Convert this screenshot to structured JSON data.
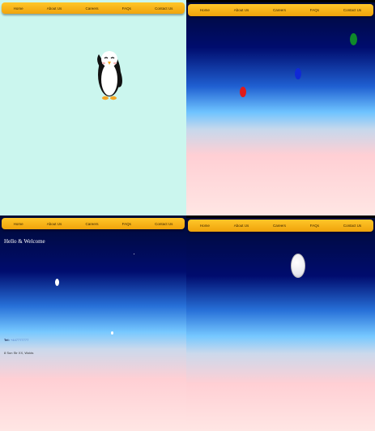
{
  "nav": {
    "items": [
      "Home",
      "About Us",
      "Careers",
      "FAQs",
      "Contact Us"
    ]
  },
  "hero": {
    "heading": "Hello & Welcome"
  },
  "contact": {
    "phone_label": "Tel:",
    "phone": "+447777777",
    "address": "8 Sun Str XX, Wolds"
  },
  "colors": {
    "nav": "#ffc629",
    "panel1_bg": "#cbf6ee",
    "balloon_red": "#e11b1b",
    "balloon_blue": "#1029d6",
    "balloon_green": "#0f8a2a"
  },
  "icons": [
    "penguin-icon"
  ]
}
